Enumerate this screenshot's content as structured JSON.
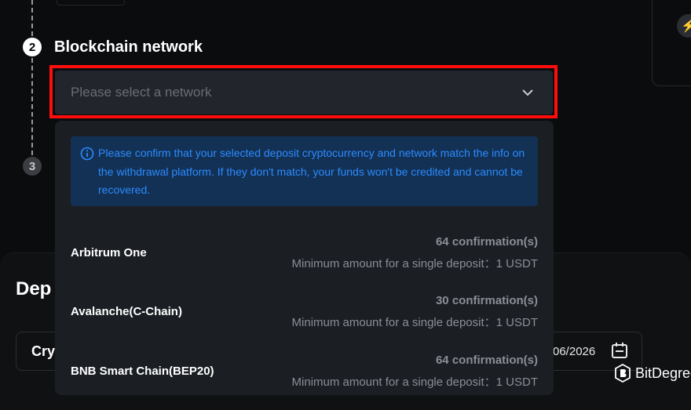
{
  "stepper": {
    "step2_number": "2",
    "step3_number": "3",
    "section_title": "Blockchain network"
  },
  "network_select": {
    "placeholder": "Please select a network"
  },
  "dropdown": {
    "notice": "Please confirm that your selected deposit cryptocurrency and network match the info on the withdrawal platform. If they don't match, your funds won't be credited and cannot be recovered.",
    "networks": [
      {
        "name": "Arbitrum One",
        "confirmations": "64 confirmation(s)",
        "minimum": "Minimum amount for a single deposit：1 USDT"
      },
      {
        "name": "Avalanche(C-Chain)",
        "confirmations": "30 confirmation(s)",
        "minimum": "Minimum amount for a single deposit：1 USDT"
      },
      {
        "name": "BNB Smart Chain(BEP20)",
        "confirmations": "64 confirmation(s)",
        "minimum": "Minimum amount for a single deposit：1 USDT"
      }
    ]
  },
  "background": {
    "deposit_title": "Dep",
    "crypto_label": "Cry",
    "date_text": "06/2026"
  },
  "watermark": {
    "brand": "BitDegree"
  },
  "colors": {
    "highlight": "#ff0d0d",
    "notice_text": "#2d8bff",
    "notice_bg": "#123155"
  },
  "icons": {
    "chevron": "chevron-down-icon",
    "info": "info-icon",
    "calendar": "calendar-icon",
    "right_card": "bolt-icon"
  }
}
